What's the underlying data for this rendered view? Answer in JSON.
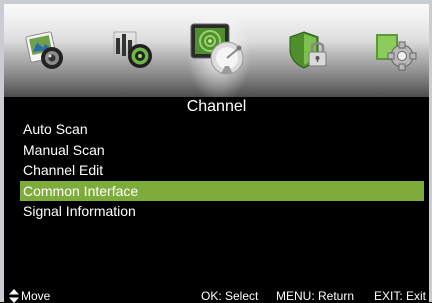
{
  "menu": {
    "icons": [
      {
        "name": "picture-icon"
      },
      {
        "name": "sound-icon"
      },
      {
        "name": "channel-icon",
        "active": true
      },
      {
        "name": "lock-icon"
      },
      {
        "name": "setup-icon"
      }
    ],
    "title": "Channel",
    "items": [
      {
        "label": "Auto Scan"
      },
      {
        "label": "Manual Scan"
      },
      {
        "label": "Channel Edit"
      },
      {
        "label": "Common Interface",
        "selected": true
      },
      {
        "label": "Signal Information"
      }
    ]
  },
  "footer": {
    "move_icon": "up-down-arrows-icon",
    "move": "Move",
    "select": "OK: Select",
    "return": "MENU: Return",
    "exit": "EXIT: Exit"
  },
  "colors": {
    "selection": "#7dac3a",
    "background": "#000000",
    "frame": "#c9ccd0"
  }
}
